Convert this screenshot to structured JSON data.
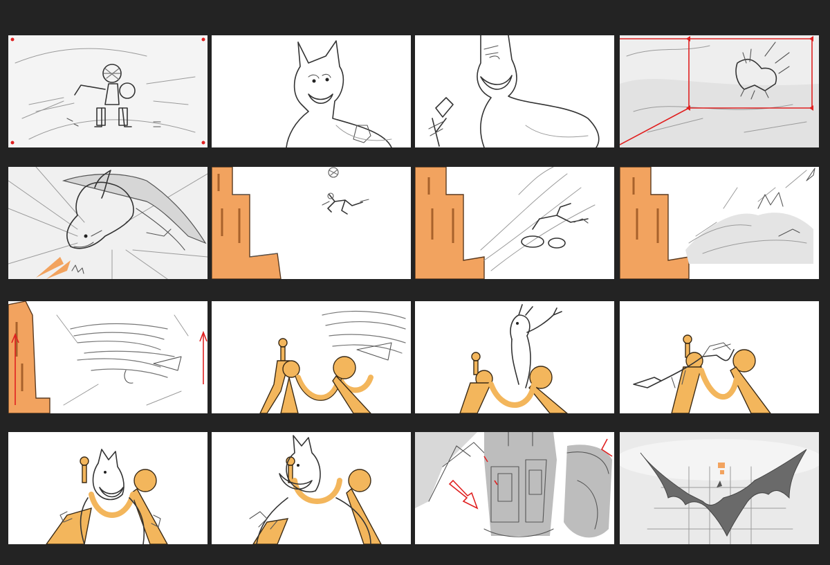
{
  "storyboard": {
    "rows": 4,
    "columns": 4,
    "background_color": "#232323",
    "panel_color": "#ffffff",
    "accent_colors": {
      "orange": "#f2a35f",
      "gold": "#f3b65c",
      "markup_red": "#e02020"
    },
    "panels": [
      {
        "id": 1,
        "icon": "knight-sword-sketch-icon"
      },
      {
        "id": 2,
        "icon": "wolf-closeup-sketch-icon"
      },
      {
        "id": 3,
        "icon": "wolf-grin-sketch-icon"
      },
      {
        "id": 4,
        "icon": "dragon-framing-sketch-icon"
      },
      {
        "id": 5,
        "icon": "dragon-dive-sketch-icon"
      },
      {
        "id": 6,
        "icon": "figure-leap-sketch-icon"
      },
      {
        "id": 7,
        "icon": "figure-dash-sketch-icon"
      },
      {
        "id": 8,
        "icon": "debris-splash-sketch-icon"
      },
      {
        "id": 9,
        "icon": "pillar-rise-sketch-icon"
      },
      {
        "id": 10,
        "icon": "golden-rig-sketch-icon"
      },
      {
        "id": 11,
        "icon": "figure-arms-up-sketch-icon"
      },
      {
        "id": 12,
        "icon": "dragon-in-rig-sketch-icon"
      },
      {
        "id": 13,
        "icon": "wolf-in-rig-sketch-icon"
      },
      {
        "id": 14,
        "icon": "wolf-grab-sketch-icon"
      },
      {
        "id": 15,
        "icon": "mech-legs-sketch-icon"
      },
      {
        "id": 16,
        "icon": "bat-wing-creature-icon"
      }
    ]
  }
}
